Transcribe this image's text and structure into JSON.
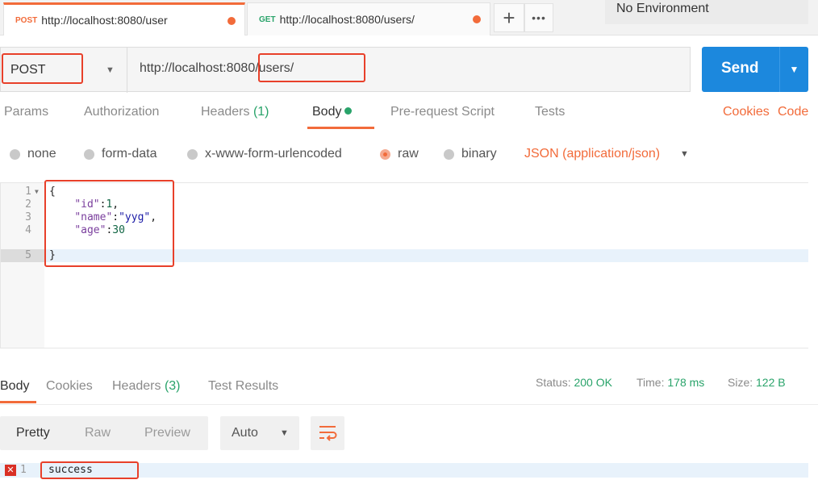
{
  "tabs": [
    {
      "method": "POST",
      "url": "http://localhost:8080/user",
      "unsaved": true,
      "active": true
    },
    {
      "method": "GET",
      "url": "http://localhost:8080/users/",
      "unsaved": true,
      "active": false
    }
  ],
  "tab_actions": {
    "new_tab": "+",
    "more": "•••"
  },
  "environment": "No Environment",
  "request": {
    "method": "POST",
    "url": "http://localhost:8080/users/",
    "send_label": "Send"
  },
  "request_tabs": {
    "params": "Params",
    "authorization": "Authorization",
    "headers": "Headers",
    "headers_count": "(1)",
    "body": "Body",
    "prerequest": "Pre-request Script",
    "tests": "Tests",
    "cookies": "Cookies",
    "code": "Code"
  },
  "body_types": {
    "none": "none",
    "form_data": "form-data",
    "urlencoded": "x-www-form-urlencoded",
    "raw": "raw",
    "binary": "binary",
    "selected": "raw",
    "content_type": "JSON (application/json)"
  },
  "editor": {
    "line_numbers": [
      "1",
      "2",
      "3",
      "4",
      "5"
    ],
    "l1": "{",
    "l2_key": "\"id\"",
    "l2_val": "1",
    "l3_key": "\"name\"",
    "l3_val": "\"yyg\"",
    "l4_key": "\"age\"",
    "l4_val": "30",
    "l5": "}"
  },
  "response_tabs": {
    "body": "Body",
    "cookies": "Cookies",
    "headers": "Headers",
    "headers_count": "(3)",
    "test_results": "Test Results"
  },
  "response_status": {
    "status_label": "Status:",
    "status_value": "200 OK",
    "time_label": "Time:",
    "time_value": "178 ms",
    "size_label": "Size:",
    "size_value": "122 B"
  },
  "response_view": {
    "pretty": "Pretty",
    "raw": "Raw",
    "preview": "Preview",
    "format": "Auto"
  },
  "response_body": {
    "line_number": "1",
    "text": "success"
  },
  "colors": {
    "accent": "#f26b3a",
    "send": "#1c88dd",
    "success": "#29a36a",
    "annotation": "#e8402a"
  }
}
